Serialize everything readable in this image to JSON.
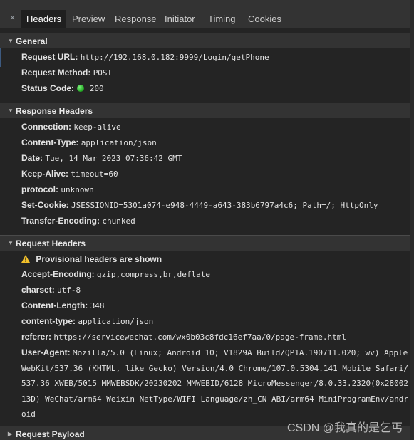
{
  "tabs": {
    "close_glyph": "×",
    "items": [
      "Headers",
      "Preview",
      "Response",
      "Initiator",
      "Timing",
      "Cookies"
    ]
  },
  "general": {
    "title": "General",
    "request_url_label": "Request URL:",
    "request_url": "http://192.168.0.182:9999/Login/getPhone",
    "request_method_label": "Request Method:",
    "request_method": "POST",
    "status_code_label": "Status Code:",
    "status_code": "200",
    "status_color": "#22b322"
  },
  "response_headers": {
    "title": "Response Headers",
    "items": [
      {
        "k": "Connection:",
        "v": "keep-alive"
      },
      {
        "k": "Content-Type:",
        "v": "application/json"
      },
      {
        "k": "Date:",
        "v": "Tue, 14 Mar 2023 07:36:42 GMT"
      },
      {
        "k": "Keep-Alive:",
        "v": "timeout=60"
      },
      {
        "k": "protocol:",
        "v": "unknown"
      },
      {
        "k": "Set-Cookie:",
        "v": "JSESSIONID=5301a074-e948-4449-a643-383b6797a4c6; Path=/; HttpOnly"
      },
      {
        "k": "Transfer-Encoding:",
        "v": "chunked"
      }
    ]
  },
  "request_headers": {
    "title": "Request Headers",
    "provisional_warning": "Provisional headers are shown",
    "items": [
      {
        "k": "Accept-Encoding:",
        "v": "gzip,compress,br,deflate"
      },
      {
        "k": "charset:",
        "v": "utf-8"
      },
      {
        "k": "Content-Length:",
        "v": "348"
      },
      {
        "k": "content-type:",
        "v": "application/json"
      },
      {
        "k": "referer:",
        "v": "https://servicewechat.com/wx0b03c8fdc16ef7aa/0/page-frame.html"
      }
    ],
    "user_agent_label": "User-Agent:",
    "user_agent_lines": [
      "Mozilla/5.0 (Linux; Android 10; V1829A Build/QP1A.190711.020; wv) Apple",
      "WebKit/537.36 (KHTML, like Gecko) Version/4.0 Chrome/107.0.5304.141 Mobile Safari/",
      "537.36 XWEB/5015 MMWEBSDK/20230202 MMWEBID/6128 MicroMessenger/8.0.33.2320(0x28002",
      "13D) WeChat/arm64 Weixin NetType/WIFI Language/zh_CN ABI/arm64 MiniProgramEnv/andr",
      "oid"
    ]
  },
  "request_payload": {
    "title": "Request Payload"
  },
  "watermark": "CSDN @我真的是乞丐"
}
